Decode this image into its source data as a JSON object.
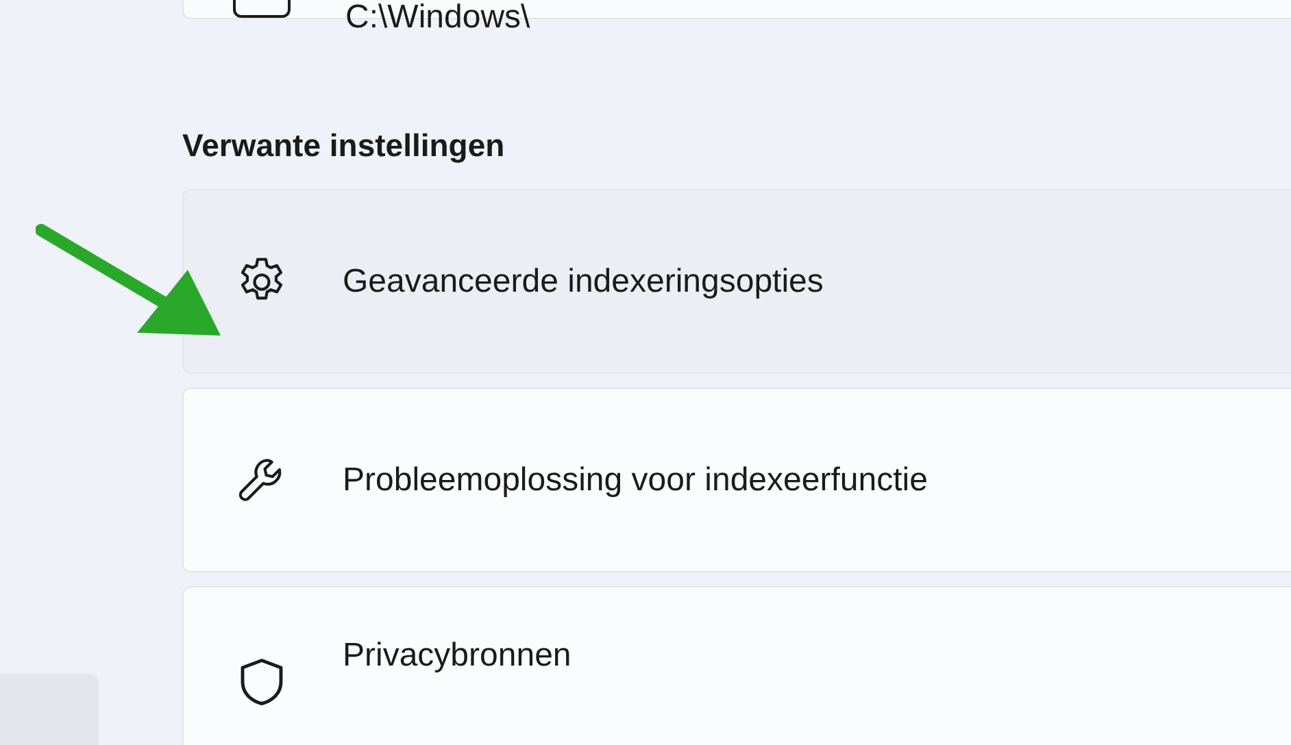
{
  "location_card": {
    "path": "C:\\Windows\\"
  },
  "section_title": "Verwante instellingen",
  "items": [
    {
      "label": "Geavanceerde indexeringsopties",
      "kind": "gear",
      "hovered": true
    },
    {
      "label": "Probleemoplossing voor indexeerfunctie",
      "kind": "wrench",
      "hovered": false
    },
    {
      "label": "Privacybronnen",
      "kind": "shield",
      "hovered": false
    }
  ]
}
